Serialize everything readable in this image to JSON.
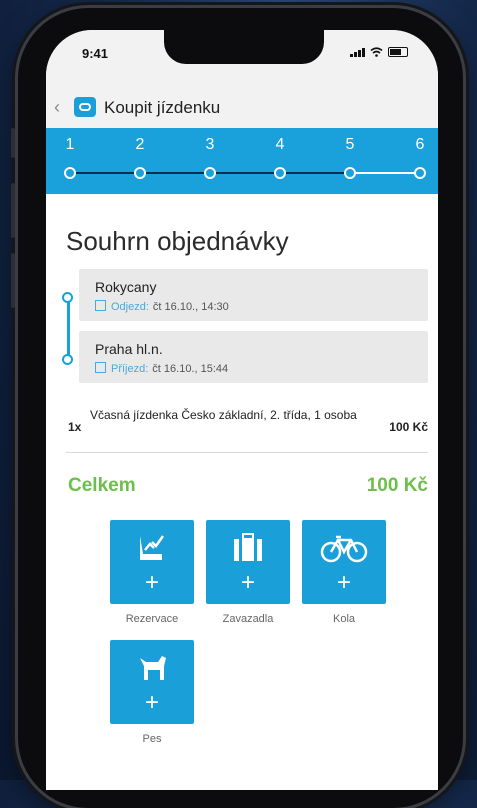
{
  "status_bar": {
    "time": "9:41"
  },
  "header": {
    "title": "Koupit jízdenku",
    "back_icon": "chevron-left-icon",
    "app_icon": "ticket-app-icon"
  },
  "steps": [
    "1",
    "2",
    "3",
    "4",
    "5",
    "6"
  ],
  "summary": {
    "title": "Souhrn objednávky",
    "departure": {
      "station": "Rokycany",
      "label": "Odjezd:",
      "datetime": "čt 16.10., 14:30"
    },
    "arrival": {
      "station": "Praha hl.n.",
      "label": "Příjezd:",
      "datetime": "čt 16.10., 15:44"
    },
    "item": {
      "qty": "1x",
      "description": "Včasná jízdenka Česko základní, 2. třída, 1 osoba",
      "price": "100 Kč"
    },
    "total": {
      "label": "Celkem",
      "value": "100 Kč"
    }
  },
  "addons": [
    {
      "label": "Rezervace",
      "icon": "seat-reservation-icon",
      "plus": "+"
    },
    {
      "label": "Zavazadla",
      "icon": "luggage-icon",
      "plus": "+"
    },
    {
      "label": "Kola",
      "icon": "bicycle-icon",
      "plus": "+"
    },
    {
      "label": "Pes",
      "icon": "dog-icon",
      "plus": "+"
    }
  ],
  "colors": {
    "accent": "#1aa0da",
    "total": "#6cc04a",
    "progress_dark": "#0b2e52"
  }
}
